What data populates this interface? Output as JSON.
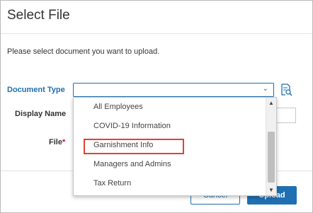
{
  "dialog": {
    "title": "Select File",
    "instructions": "Please select document you want to upload."
  },
  "form": {
    "document_type_label": "Document Type",
    "document_type_value": "",
    "display_name_label": "Display Name",
    "file_label": "File",
    "file_required_mark": "*"
  },
  "dropdown": {
    "options": [
      "All Employees",
      "COVID-19 Information",
      "Garnishment Info",
      "Managers and Admins",
      "Tax Return"
    ],
    "highlighted": "Garnishment Info"
  },
  "footer": {
    "cancel_label": "Cancel",
    "upload_label": "Upload"
  },
  "icons": {
    "lookup": "document-search-icon",
    "chevron": "chevron-down-icon"
  },
  "colors": {
    "accent": "#1f6fb2",
    "highlight_border": "#e0403a",
    "required": "#c8102e"
  }
}
